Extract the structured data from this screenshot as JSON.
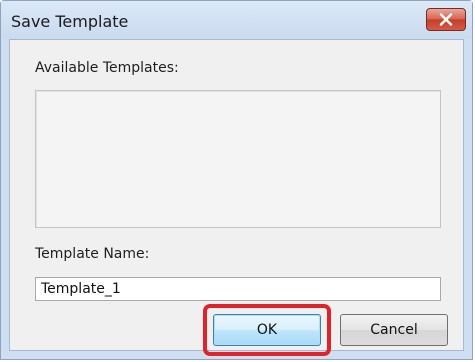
{
  "dialog": {
    "title": "Save Template",
    "close_icon": "close-x-icon"
  },
  "available_templates": {
    "label": "Available Templates:",
    "items": []
  },
  "template_name": {
    "label": "Template Name:",
    "value": "Template_1"
  },
  "buttons": {
    "ok_label": "OK",
    "cancel_label": "Cancel"
  },
  "colors": {
    "close_button": "#d6604d",
    "highlight": "#e0222a"
  }
}
